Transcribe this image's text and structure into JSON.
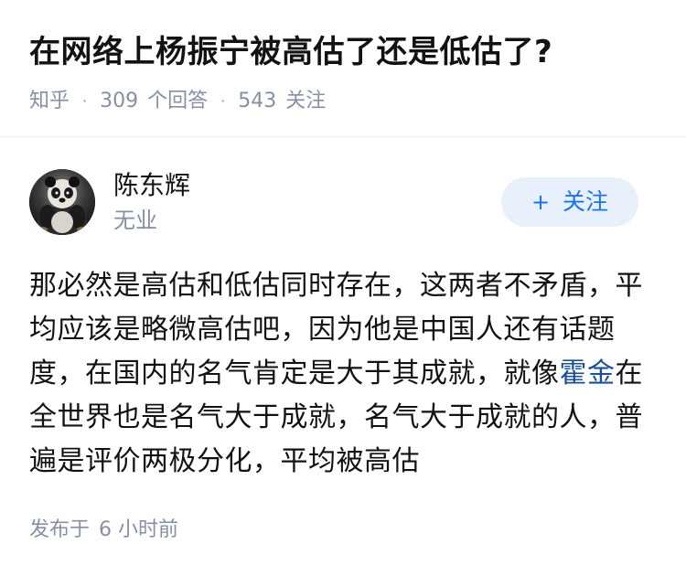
{
  "question": {
    "title": "在网络上杨振宁被高估了还是低估了?",
    "meta": {
      "source": "知乎",
      "answers_count": "309",
      "answers_label": "个回答",
      "followers_count": "543",
      "followers_label": "关注"
    }
  },
  "answer": {
    "author": {
      "name": "陈东辉",
      "bio": "无业",
      "avatar_icon": "panda-avatar"
    },
    "follow_button": {
      "icon": "plus-icon",
      "label": "关注"
    },
    "content": {
      "part1": "那必然是高估和低估同时存在，这两者不矛盾，平均应该是略微高估吧，因为他是中国人还有话题度，在国内的名气肯定是大于其成就，就像",
      "link": "霍金",
      "part2": "在全世界也是名气大于成就，名气大于成就的人，普遍是评价两极分化，平均被高估"
    },
    "time": {
      "prefix": "发布于",
      "value": "6 小时前"
    }
  },
  "colors": {
    "text": "#121212",
    "meta": "#8590a6",
    "accent": "#1772f6",
    "accent_bg": "#e8f1fb",
    "link": "#175199"
  }
}
